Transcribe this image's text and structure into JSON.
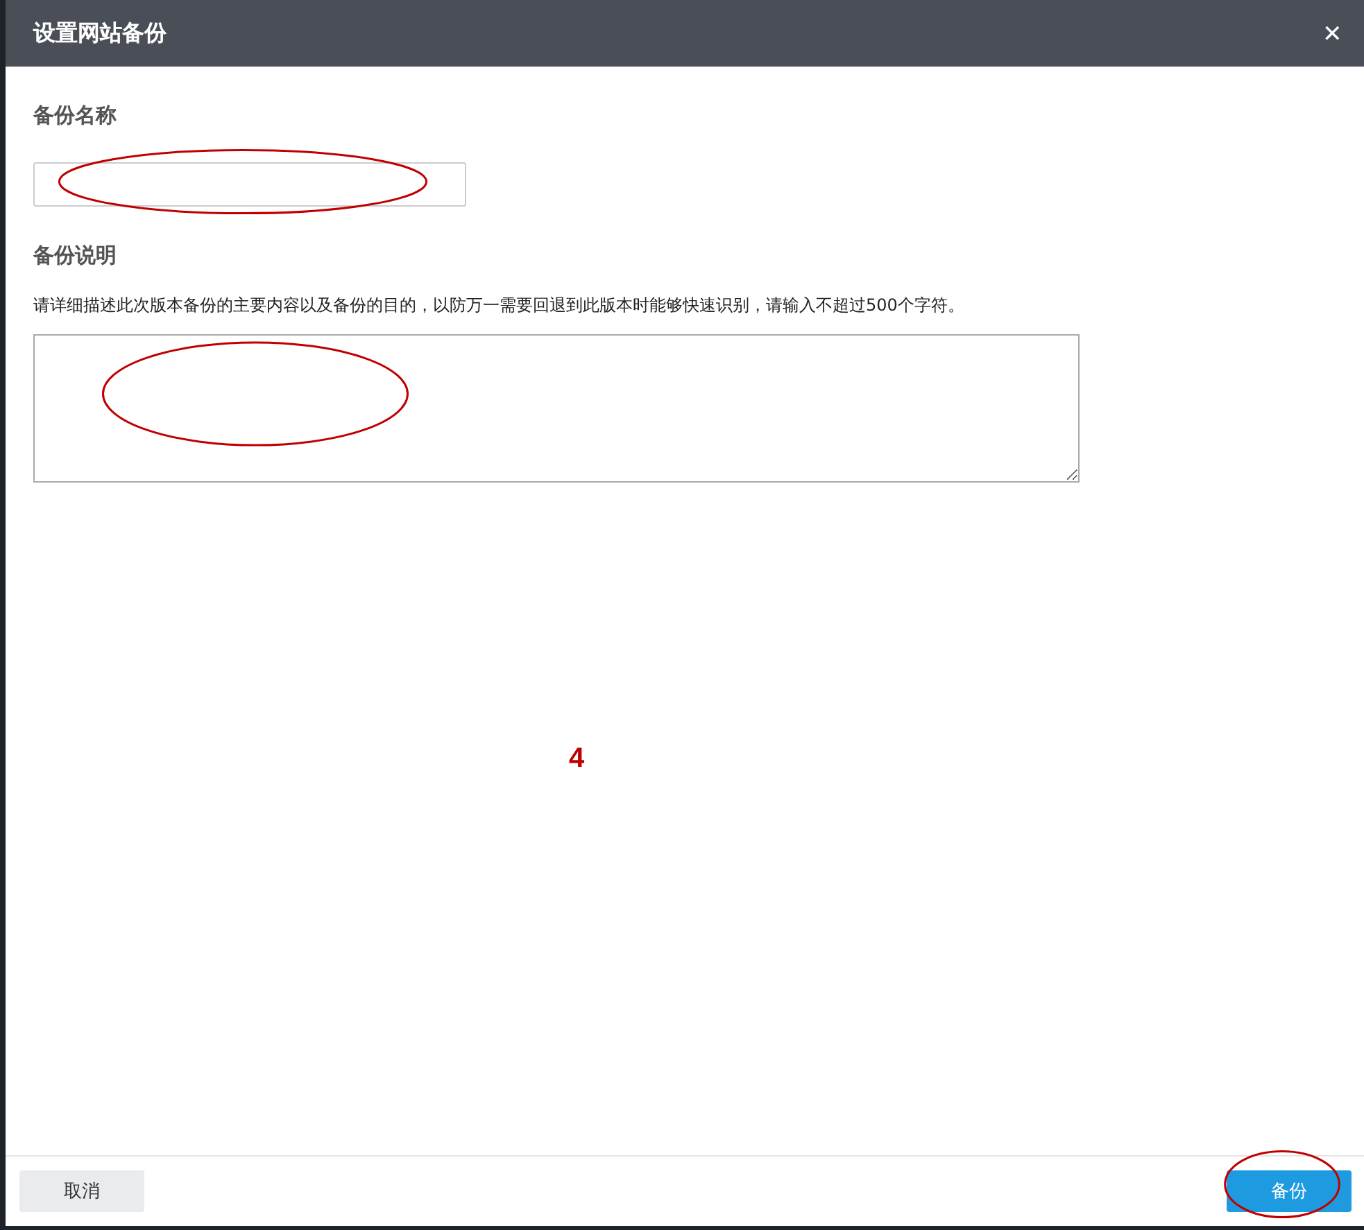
{
  "dialog": {
    "title": "设置网站备份",
    "close_icon": "✕"
  },
  "name_section": {
    "label": "备份名称",
    "field": {
      "highlighted": true
    }
  },
  "description_section": {
    "label": "备份说明",
    "hint": "请详细描述此次版本备份的主要内容以及备份的目的，以防万一需要回退到此版本时能够快速识别，请输入不超过500个字符。",
    "field": {
      "highlighted": true
    }
  },
  "step_number": "4",
  "footer": {
    "buttons": [
      {
        "label": "取消",
        "kind": "secondary",
        "highlighted": false
      },
      {
        "label": "备份",
        "kind": "primary",
        "highlighted": true
      }
    ]
  }
}
